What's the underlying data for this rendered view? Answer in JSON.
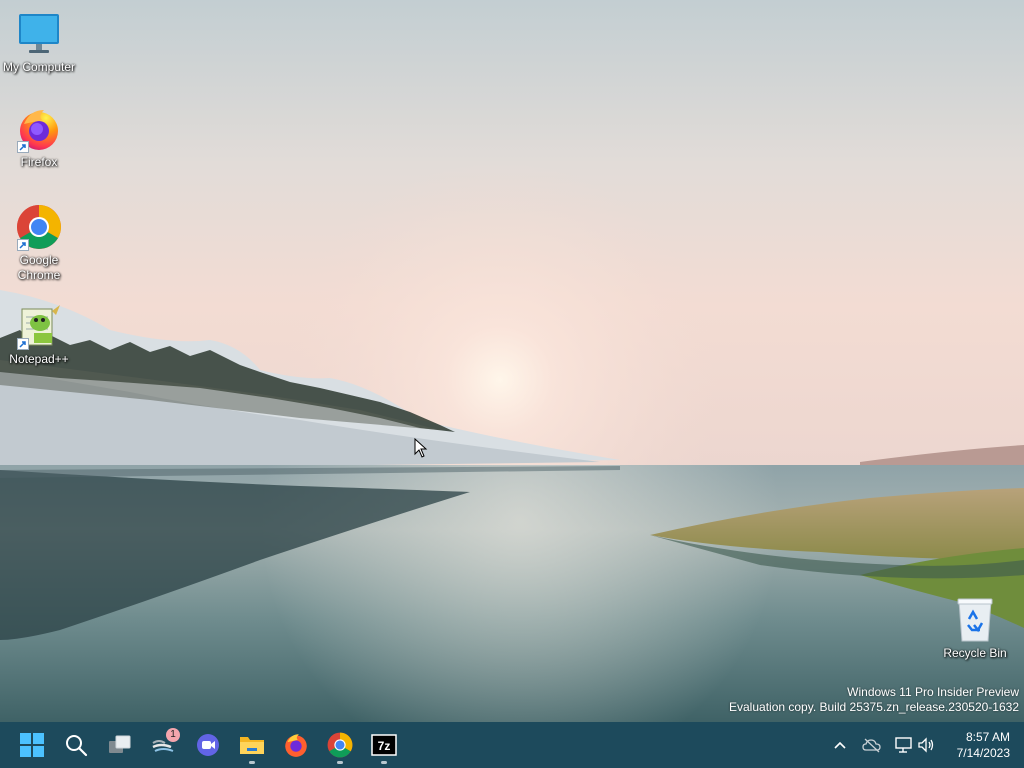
{
  "desktop": {
    "icons": [
      {
        "label": "My Computer",
        "icon": "monitor-icon"
      },
      {
        "label": "Firefox",
        "icon": "firefox-icon"
      },
      {
        "label": "Google Chrome",
        "icon": "chrome-icon"
      },
      {
        "label": "Notepad++",
        "icon": "notepad-plus-plus-icon"
      },
      {
        "label": "Recycle Bin",
        "icon": "recycle-bin-icon"
      }
    ]
  },
  "watermark": {
    "line1": "Windows 11 Pro Insider Preview",
    "line2": "Evaluation copy. Build 25375.zn_release.230520-1632"
  },
  "taskbar": {
    "apps": [
      {
        "name": "Start",
        "icon": "windows-start-icon"
      },
      {
        "name": "Search",
        "icon": "search-icon"
      },
      {
        "name": "Task View",
        "icon": "task-view-icon"
      },
      {
        "name": "Widgets",
        "icon": "widgets-icon",
        "badge": "1"
      },
      {
        "name": "Chat",
        "icon": "chat-icon"
      },
      {
        "name": "File Explorer",
        "icon": "folder-icon",
        "running": true
      },
      {
        "name": "Firefox",
        "icon": "firefox-icon"
      },
      {
        "name": "Google Chrome",
        "icon": "chrome-icon",
        "running": true
      },
      {
        "name": "7-Zip",
        "icon": "7zip-icon",
        "running": true
      }
    ],
    "tray": {
      "icons": [
        "chevron-up-icon",
        "onedrive-icon",
        "network-icon",
        "volume-icon"
      ],
      "time": "8:57 AM",
      "date": "7/14/2023"
    }
  },
  "colors": {
    "taskbar_bg": "#1d4a5c",
    "sky_top": "#c9d3d6",
    "sky_glow": "#f6dcd3",
    "water": "#5e7f82"
  }
}
